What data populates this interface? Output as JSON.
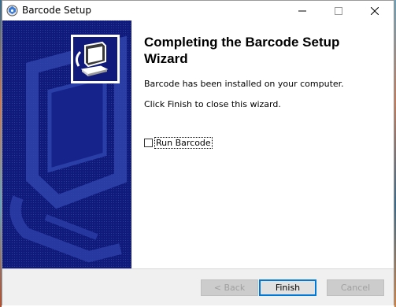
{
  "window": {
    "title": "Barcode Setup",
    "icon": "setup-disc-icon"
  },
  "controls": {
    "minimize_icon": "minimize-icon",
    "maximize_icon": "maximize-icon",
    "close_icon": "close-icon"
  },
  "wizard": {
    "heading": "Completing the Barcode Setup Wizard",
    "installed_text": "Barcode has been installed on your computer.",
    "finish_text": "Click Finish to close this wizard.",
    "run_option": {
      "label": "Run Barcode",
      "checked": false
    }
  },
  "buttons": {
    "back": {
      "label": "< Back",
      "enabled": false
    },
    "finish": {
      "label": "Finish",
      "enabled": true,
      "default": true
    },
    "cancel": {
      "label": "Cancel",
      "enabled": false
    }
  },
  "colors": {
    "side_panel": "#0f1a7a",
    "default_button_border": "#0078d7"
  }
}
